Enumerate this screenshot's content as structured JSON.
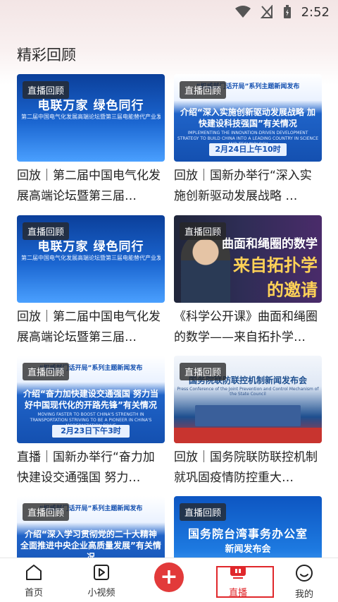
{
  "status": {
    "time": "2:52"
  },
  "section": {
    "title": "精彩回顾"
  },
  "cards": [
    {
      "badge": "直播回顾",
      "title": "回放｜第二届中国电气化发展高端论坛暨第三届…",
      "thumb": {
        "line1": "电联万家 绿色同行",
        "line2": "第二届中国电气化发展高端论坛暨第三届电能替代产业发展高峰论坛"
      }
    },
    {
      "badge": "直播回顾",
      "title": "回放｜国新办举行“深入实施创新驱动发展战略 …",
      "thumb": {
        "top": "“权威部门话开局”系列主题新闻发布",
        "line1": "介绍“深入实施创新驱动发展战略 加快建设科技强国”有关情况",
        "line2": "IMPLEMENTING THE INNOVATION-DRIVEN DEVELOPMENT STRATEGY TO BUILD CHINA INTO A LEADING COUNTRY IN SCIENCE AND TECHNOLOGY",
        "date": "2月24日上午10时"
      }
    },
    {
      "badge": "直播回顾",
      "title": "回放｜第二届中国电气化发展高端论坛暨第三届…",
      "thumb": {
        "line1": "电联万家 绿色同行",
        "line2": "第二届中国电气化发展高端论坛暨第三届电能替代产业发展高峰论坛"
      }
    },
    {
      "badge": "直播回顾",
      "title": "《科学公开课》曲面和绳圈的数学——来自拓扑学…",
      "thumb": {
        "line1": "曲面和绳圈的数学",
        "line2": "来自拓扑学",
        "line3": "的邀请"
      }
    },
    {
      "badge": "直播回顾",
      "title": "直播｜国新办举行“奋力加快建设交通强国 努力…",
      "thumb": {
        "top": "“权威部门话开局”系列主题新闻发布",
        "line1": "介绍“奋力加快建设交通强国 努力当好中国现代化的开路先锋”有关情况",
        "line2": "MOVING FASTER TO BOOST CHINA'S STRENGTH IN TRANSPORTATION STRIVING TO BE A PIONEER IN CHINA'S MODERNIZATION DRIVE",
        "date": "2月23日下午3时"
      }
    },
    {
      "badge": "直播回顾",
      "title": "回放｜国务院联防联控机制就巩固疫情防控重大…",
      "thumb": {
        "line1": "国务院联防联控机制新闻发布会",
        "line2": "Press Conference of the Joint Prevention and Control Mechanism of the State Council"
      }
    },
    {
      "badge": "直播回顾",
      "title": "",
      "thumb": {
        "top": "“权威部门话开局”系列主题新闻发布",
        "line1": "介绍“深入学习贯彻党的二十大精神 全面推进中央企业高质量发展”有关情况"
      }
    },
    {
      "badge": "直播回顾",
      "title": "",
      "thumb": {
        "line1": "国务院台湾事务办公室",
        "line2": "新闻发布会"
      }
    }
  ],
  "nav": {
    "home": "首页",
    "video": "小视频",
    "live": "直播",
    "mine": "我的",
    "fab": "+"
  },
  "colors": {
    "accent": "#e0272b"
  }
}
